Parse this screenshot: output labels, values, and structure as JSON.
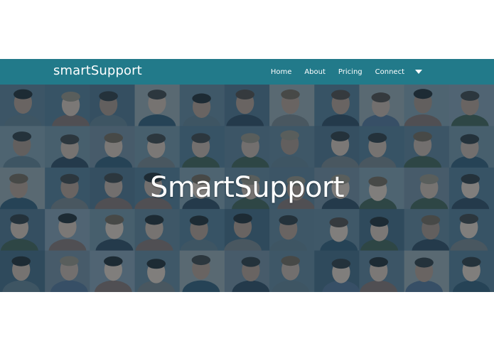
{
  "navbar": {
    "brand": "smartSupport",
    "links": [
      {
        "label": "Home"
      },
      {
        "label": "About"
      },
      {
        "label": "Pricing"
      },
      {
        "label": "Connect"
      }
    ],
    "dropdown_icon": "caret-down-icon"
  },
  "hero": {
    "title": "SmartSupport",
    "background": "photo-mosaic-of-faces"
  },
  "colors": {
    "navbar_bg": "#227a8a",
    "hero_overlay": "#1c3c50",
    "text": "#ffffff"
  }
}
